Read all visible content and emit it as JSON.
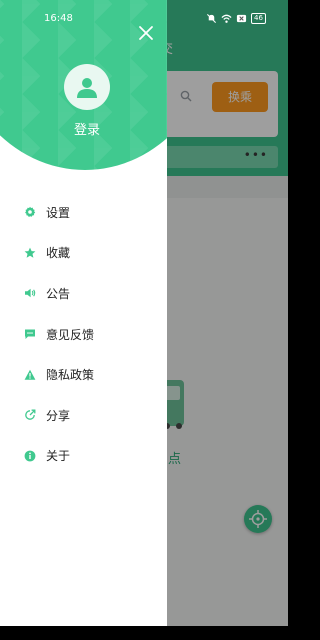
{
  "status_bar": {
    "time": "16:48",
    "battery": "46",
    "icons": [
      "mute-icon",
      "wifi-icon",
      "sim-x-icon",
      "battery-icon"
    ]
  },
  "background": {
    "header_title_fragment": "交",
    "transfer_button": "换乘",
    "empty_text_fragment": "点"
  },
  "drawer": {
    "login_label": "登录",
    "menu": [
      {
        "label": "设置",
        "icon": "gear-icon"
      },
      {
        "label": "收藏",
        "icon": "star-icon"
      },
      {
        "label": "公告",
        "icon": "speaker-icon"
      },
      {
        "label": "意见反馈",
        "icon": "chat-icon"
      },
      {
        "label": "隐私政策",
        "icon": "warning-icon"
      },
      {
        "label": "分享",
        "icon": "share-icon"
      },
      {
        "label": "关于",
        "icon": "info-icon"
      }
    ]
  },
  "colors": {
    "primary": "#40c98f",
    "accent_orange": "#ff9a1f",
    "text": "#222222"
  }
}
